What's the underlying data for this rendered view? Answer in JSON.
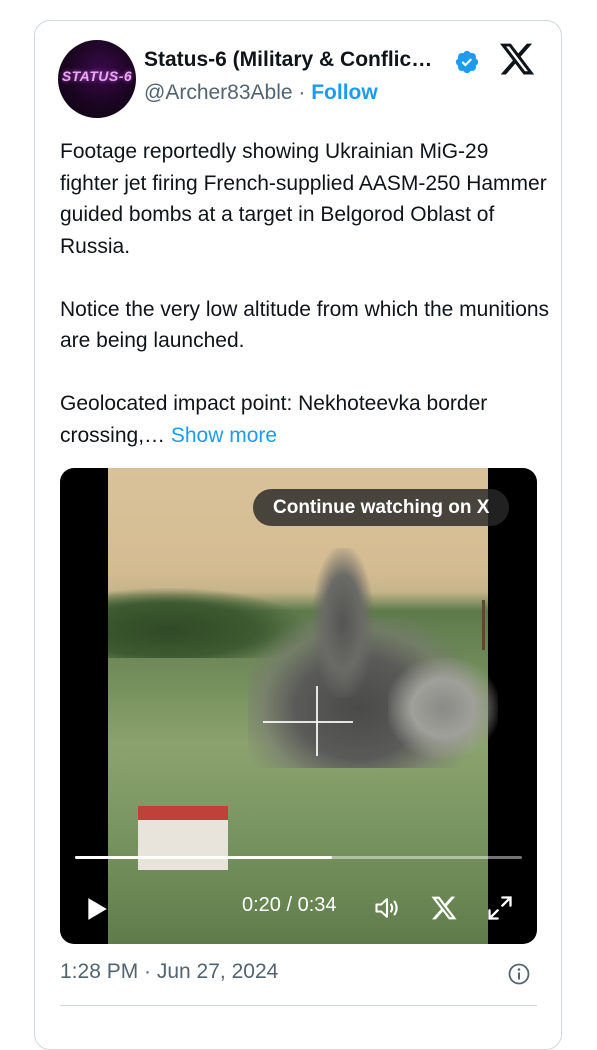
{
  "tweet": {
    "author_name": "Status-6 (Military & Conflic…",
    "handle": "@Archer83Able",
    "separator": " · ",
    "follow_label": "Follow",
    "avatar_logo_text": "STATUS-6",
    "paragraphs": [
      "Footage reportedly showing Ukrainian MiG-29 fighter jet firing French-supplied AASM-250 Hammer guided bombs at a target in Belgorod Oblast of Russia.",
      "Notice the very low altitude from which the munitions are being launched."
    ],
    "last_paragraph": "Geolocated impact point: Nekhoteevka border crossing,… ",
    "show_more_label": "Show more",
    "timestamp": "1:28 PM · Jun 27, 2024"
  },
  "video": {
    "continue_label": "Continue watching on X",
    "time_display": "0:20 / 0:34",
    "progress": 0.575
  },
  "colors": {
    "accent": "#1d9bf0",
    "secondary_text": "#536471",
    "border": "#cfd9de"
  },
  "icons": [
    "verified-badge-icon",
    "x-logo-icon",
    "play-icon",
    "volume-icon",
    "x-share-icon",
    "expand-icon",
    "info-icon"
  ]
}
